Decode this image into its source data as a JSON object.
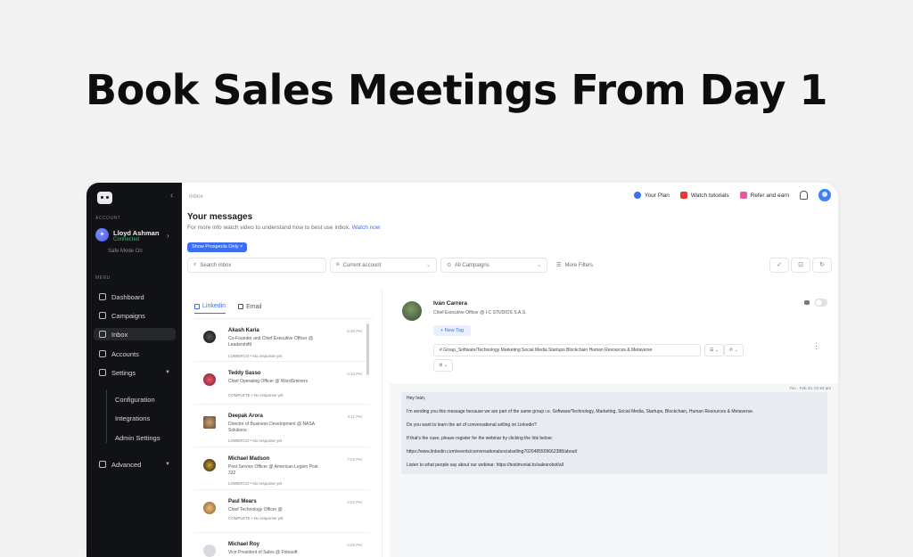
{
  "hero": {
    "headline": "Book Sales Meetings From Day 1"
  },
  "sidebar": {
    "account_label": "ACCOUNT",
    "account_name": "Lloyd Ashman",
    "account_status": "Connected",
    "safe_mode": "Safe Mode On",
    "menu_label": "MENU",
    "items": [
      {
        "label": "Dashboard",
        "icon": "dashboard-icon"
      },
      {
        "label": "Campaigns",
        "icon": "campaign-icon"
      },
      {
        "label": "Inbox",
        "icon": "inbox-icon",
        "active": true
      },
      {
        "label": "Accounts",
        "icon": "accounts-icon"
      },
      {
        "label": "Settings",
        "icon": "gear-icon"
      }
    ],
    "sub_items": [
      "Configuration",
      "Integrations",
      "Admin Settings"
    ],
    "advanced": "Advanced"
  },
  "header": {
    "breadcrumb": "Inbox",
    "your_plan": "Your Plan",
    "watch_tutorials": "Watch tutorials",
    "refer_and_earn": "Refer and earn"
  },
  "inbox": {
    "title": "Your messages",
    "subtitle": "For more info watch video to understand how to best use inbox.",
    "watch_now": "Watch now",
    "show_prospects": "Show Prospects Only",
    "search_placeholder": "Search inbox",
    "current_account": "Current account",
    "all_campaigns": "All Campaigns",
    "more_filters": "More Filters",
    "tabs": [
      "Linkedin",
      "Email"
    ]
  },
  "conversations": [
    {
      "name": "Akash Karia",
      "role": "Co-Founder and Chief Executive Officer @ Leadershiftt",
      "status": "LOWERCO • No response yet",
      "time": "6:36 PM"
    },
    {
      "name": "Teddy Sasso",
      "role": "Chief Operating Officer @ WordSminers",
      "status": "COMPLETE • No response yet",
      "time": "3:15 PM"
    },
    {
      "name": "Deepak Arora",
      "role": "Director of Business Development @ NASA Solutions",
      "status": "LOWERCO • No response yet",
      "time": "4:11 PM"
    },
    {
      "name": "Michael Madson",
      "role": "Post Service Officer @ American Legion Post 332",
      "status": "LOWERCO • No response yet",
      "time": "7:02 PM"
    },
    {
      "name": "Paul Mears",
      "role": "Chief Technology Officer @",
      "status": "COMPLETE • No response yet",
      "time": "4:22 PM"
    },
    {
      "name": "Michael Roy",
      "role": "Vice President of Sales @ Fotosoft",
      "status": "",
      "time": "3:26 PM"
    }
  ],
  "contact": {
    "name": "Iván Carrera",
    "role": "Chief Executive Officer @ I-C STUDIOS S.A.S.",
    "new_tag": "+ New Tag",
    "tags": "#  Group_Software/Technology  Marketing  Social Media  Startups  Blockchain  Human Resources & Metaverse",
    "meta": "You · Feb 23, 01:54 am"
  },
  "message": {
    "lines": [
      "Hey Iván,",
      "I'm sending you this message because we are part of the same group i.e. Software/Technology, Marketing, Social Media, Startups, Blockchain, Human Resources & Metaverse.",
      "Do you want to learn the art of conversational selling on Linkedin?",
      "If that's the case, please register for the webinar by clicking the link below:",
      "https://www.linkedin.com/events/conversationalsocialselling7020485509662388/about/",
      "Listen to what people say about our webinar: https://testimonial.to/salesrobot/all"
    ]
  },
  "colors": {
    "accent": "#3b6ef5",
    "sidebar": "#111216",
    "connected": "#2ebd6b"
  }
}
